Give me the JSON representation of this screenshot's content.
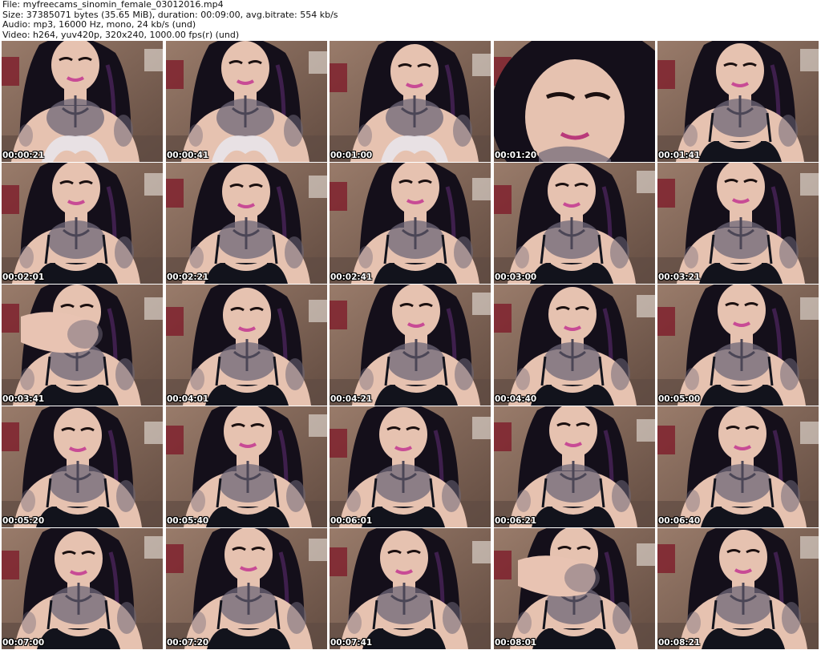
{
  "header": {
    "file": "File: myfreecams_sinomin_female_03012016.mp4",
    "size": "Size: 37385071 bytes (35.65 MiB), duration: 00:09:00, avg.bitrate: 554 kb/s",
    "audio": "Audio: mp3, 16000 Hz, mono, 24 kb/s (und)",
    "video": "Video: h264, yuv420p, 320x240, 1000.00 fps(r) (und)"
  },
  "frames": [
    {
      "time": "00:00:21",
      "variant": "bra"
    },
    {
      "time": "00:00:41",
      "variant": "bra"
    },
    {
      "time": "00:01:00",
      "variant": "bra"
    },
    {
      "time": "00:01:20",
      "variant": "closeup"
    },
    {
      "time": "00:01:41",
      "variant": "tank"
    },
    {
      "time": "00:02:01",
      "variant": "tank"
    },
    {
      "time": "00:02:21",
      "variant": "tank"
    },
    {
      "time": "00:02:41",
      "variant": "tank"
    },
    {
      "time": "00:03:00",
      "variant": "tank"
    },
    {
      "time": "00:03:21",
      "variant": "tank"
    },
    {
      "time": "00:03:41",
      "variant": "hand"
    },
    {
      "time": "00:04:01",
      "variant": "tank"
    },
    {
      "time": "00:04:21",
      "variant": "tank"
    },
    {
      "time": "00:04:40",
      "variant": "tank"
    },
    {
      "time": "00:05:00",
      "variant": "tank"
    },
    {
      "time": "00:05:20",
      "variant": "tank"
    },
    {
      "time": "00:05:40",
      "variant": "tank"
    },
    {
      "time": "00:06:01",
      "variant": "tank"
    },
    {
      "time": "00:06:21",
      "variant": "tank"
    },
    {
      "time": "00:06:40",
      "variant": "tank"
    },
    {
      "time": "00:07:00",
      "variant": "tank"
    },
    {
      "time": "00:07:20",
      "variant": "tank"
    },
    {
      "time": "00:07:41",
      "variant": "tank"
    },
    {
      "time": "00:08:01",
      "variant": "hand"
    },
    {
      "time": "00:08:21",
      "variant": "tank"
    }
  ],
  "colors": {
    "wall": "#8a6c5c",
    "hair": "#140f1a",
    "skin": "#e6c2b0",
    "tattoo": "#6d6778",
    "top": "#12131c",
    "bra": "#e8e4ea",
    "poster": "#7e1d2a"
  }
}
